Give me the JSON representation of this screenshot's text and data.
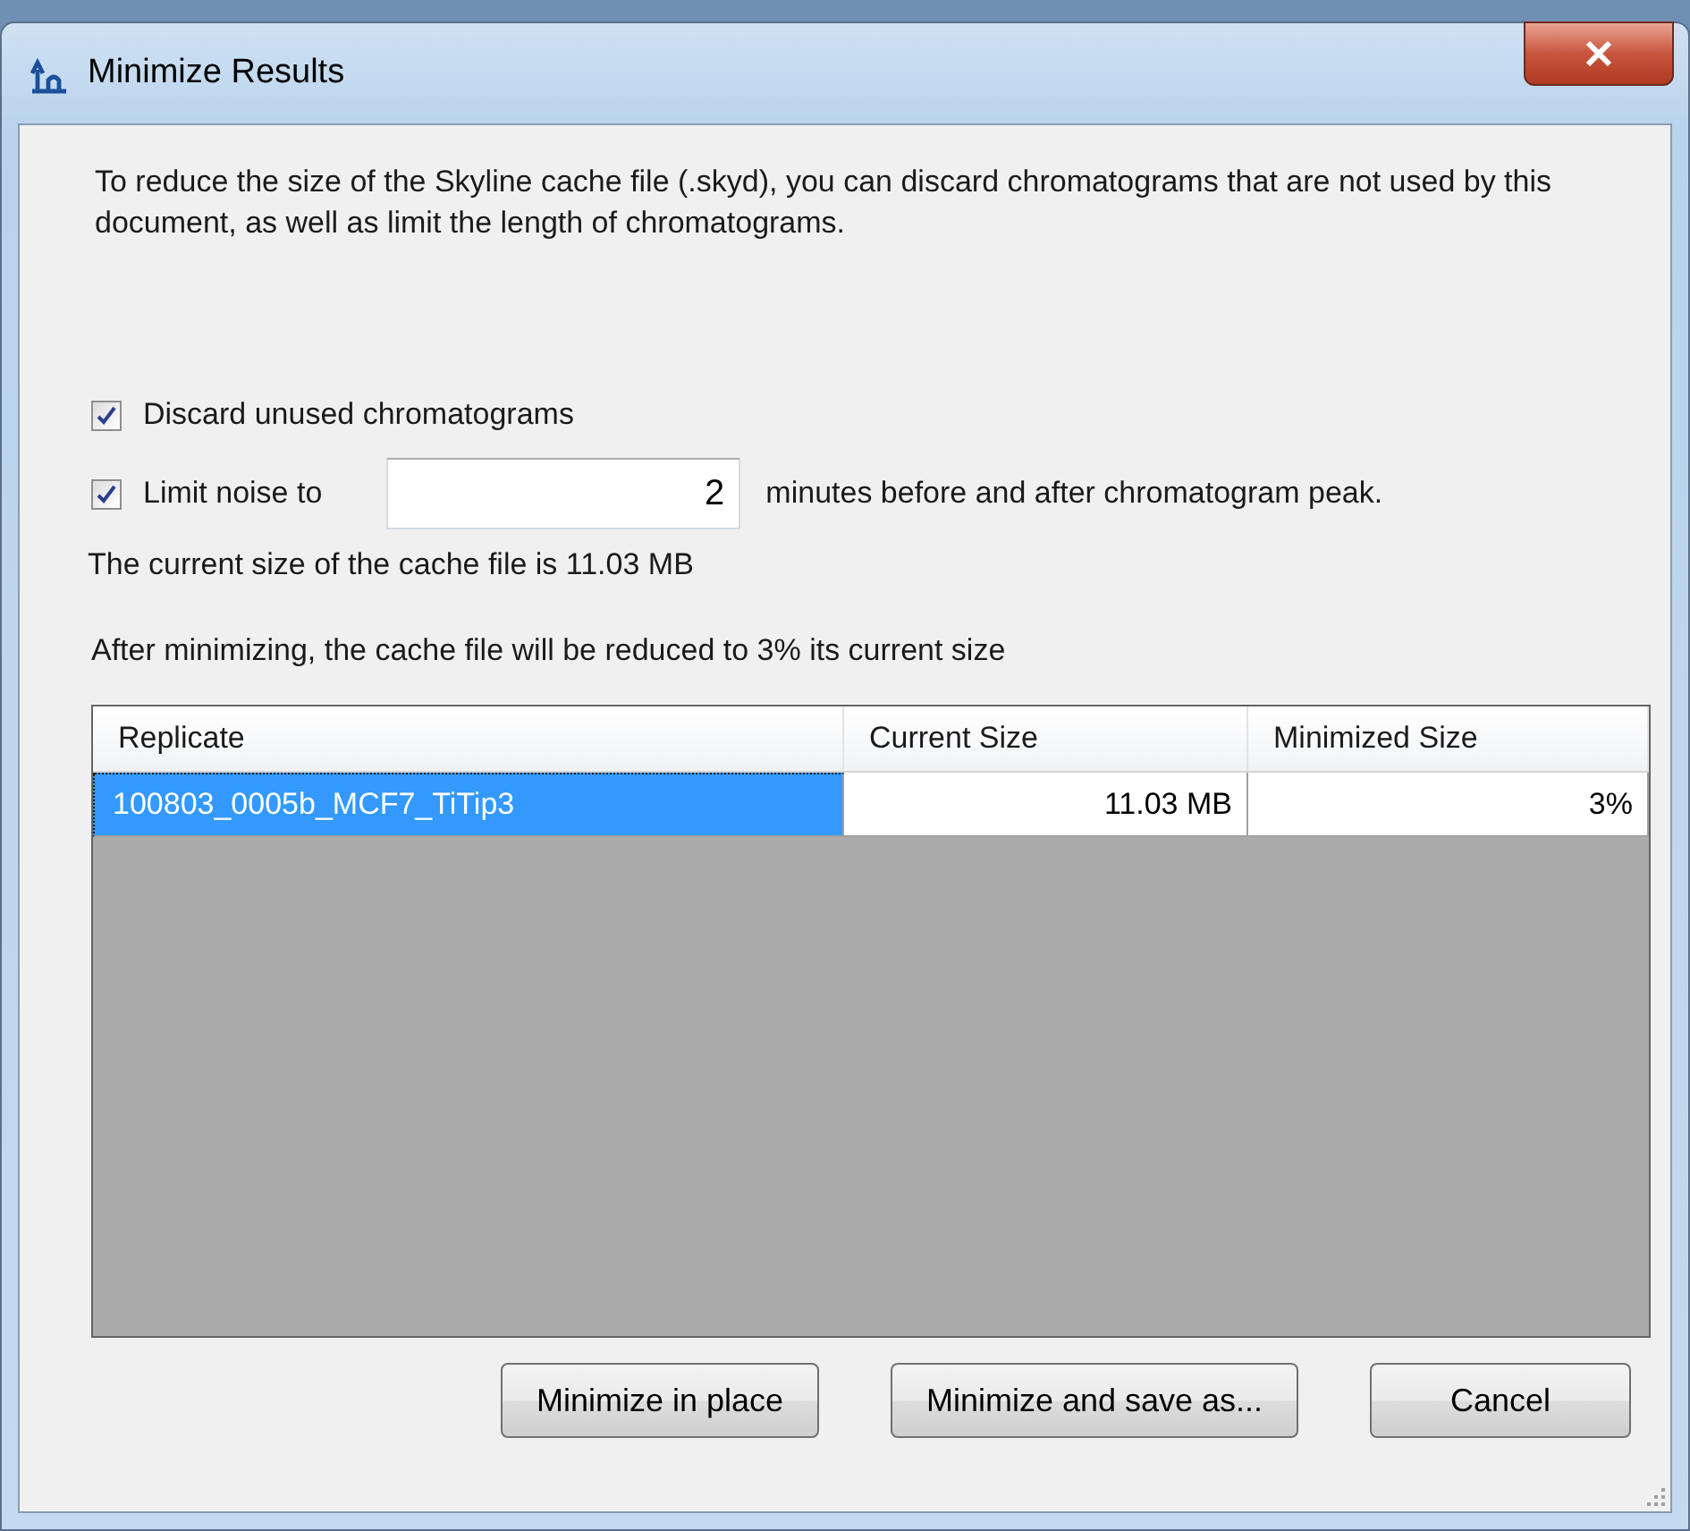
{
  "window": {
    "title": "Minimize Results"
  },
  "description": "To reduce the size of the Skyline cache file (.skyd), you can discard chromatograms that are not used by this document, as well as limit the length of chromatograms.",
  "discard_unused": {
    "label": "Discard unused chromatograms",
    "checked": true
  },
  "limit_noise": {
    "label": "Limit noise to",
    "checked": true,
    "value": "2",
    "suffix": "minutes before and after chromatogram peak."
  },
  "current_size_text": "The current size of the cache file is 11.03 MB",
  "reduction_text": "After minimizing, the cache file will be reduced to 3% its current size",
  "table": {
    "columns": [
      "Replicate",
      "Current Size",
      "Minimized Size"
    ],
    "rows": [
      {
        "replicate": "100803_0005b_MCF7_TiTip3",
        "current_size": "11.03 MB",
        "minimized_size": "3%",
        "selected": true
      }
    ]
  },
  "buttons": [
    "Minimize in place",
    "Minimize and save as...",
    "Cancel"
  ]
}
